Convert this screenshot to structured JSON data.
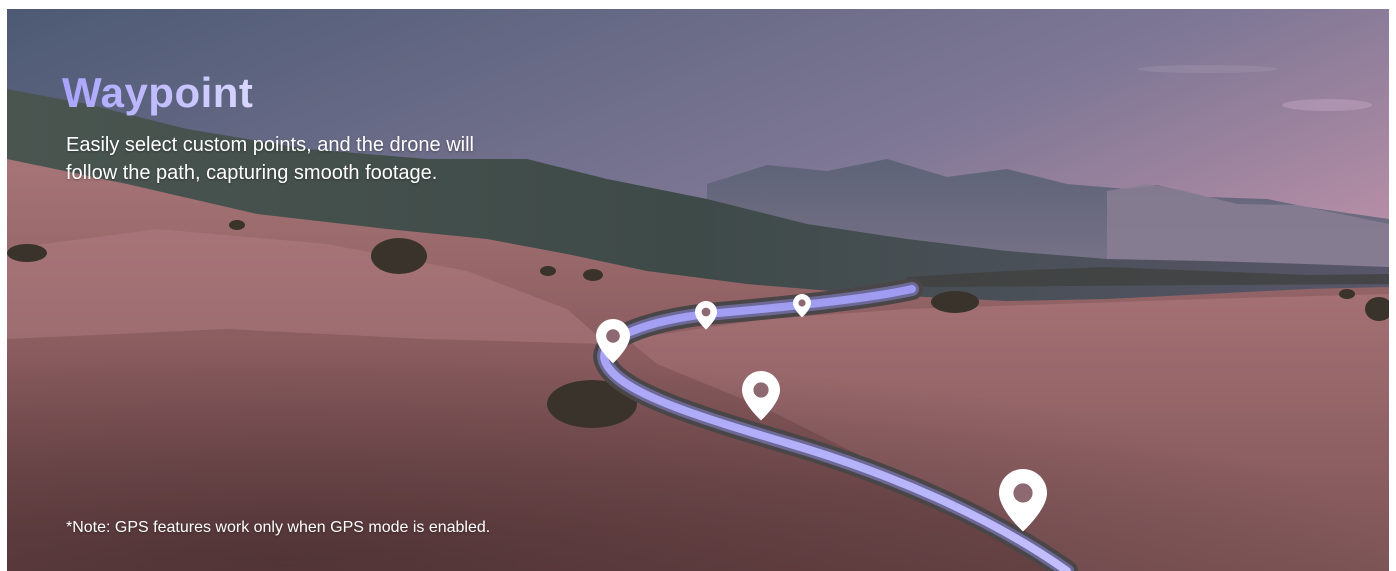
{
  "banner": {
    "title": "Waypoint",
    "description_line1": "Easily select custom points, and the drone will",
    "description_line2": "follow the path, capturing smooth footage.",
    "note": "*Note: GPS features work only when GPS mode is enabled."
  },
  "colors": {
    "title_gradient_start": "#a9a4ff",
    "title_gradient_end": "#d9d6ff",
    "path_highlight": "#b8b4ff",
    "text": "#ffffff",
    "sky_top": "#55607a",
    "sky_horizon": "#e4a3b2",
    "field": "#8a5a5c"
  },
  "icons": {
    "waypoint_marker": "map-pin-icon"
  }
}
